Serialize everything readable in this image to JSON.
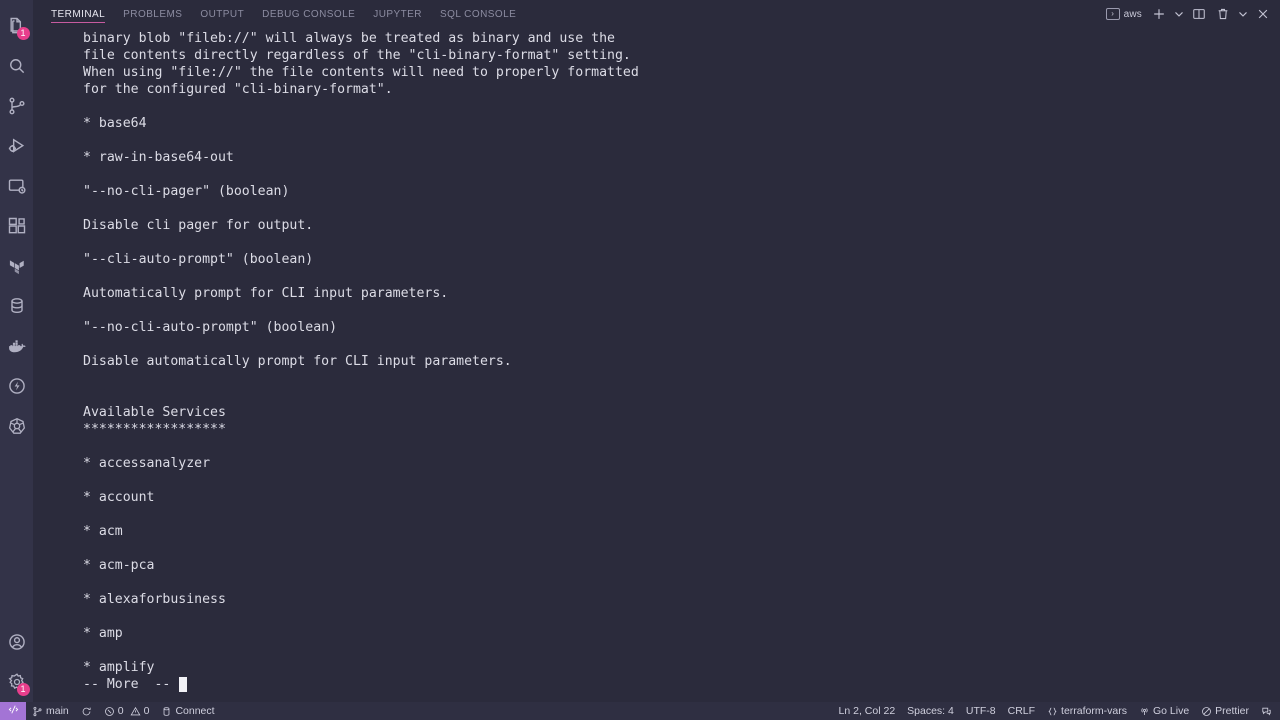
{
  "activity_bar": {
    "top_items": [
      {
        "name": "explorer",
        "icon": "files-icon",
        "badge": "1"
      },
      {
        "name": "search",
        "icon": "search-icon",
        "badge": ""
      },
      {
        "name": "source-control",
        "icon": "source-control-icon",
        "badge": ""
      },
      {
        "name": "run-and-debug",
        "icon": "run-debug-icon",
        "badge": ""
      },
      {
        "name": "remote-explorer",
        "icon": "remote-explorer-icon",
        "badge": ""
      },
      {
        "name": "extensions",
        "icon": "extensions-icon",
        "badge": ""
      },
      {
        "name": "terraform",
        "icon": "terraform-icon",
        "badge": ""
      },
      {
        "name": "database",
        "icon": "database-icon",
        "badge": ""
      },
      {
        "name": "docker",
        "icon": "docker-icon",
        "badge": ""
      },
      {
        "name": "thunder-client",
        "icon": "lightning-icon",
        "badge": ""
      },
      {
        "name": "kubernetes",
        "icon": "kubernetes-icon",
        "badge": ""
      }
    ],
    "bottom_items": [
      {
        "name": "accounts",
        "icon": "account-icon",
        "badge": ""
      },
      {
        "name": "manage-settings",
        "icon": "gear-icon",
        "badge": "1"
      }
    ]
  },
  "panel": {
    "tabs": [
      {
        "label": "TERMINAL",
        "active": true
      },
      {
        "label": "PROBLEMS",
        "active": false
      },
      {
        "label": "OUTPUT",
        "active": false
      },
      {
        "label": "DEBUG CONSOLE",
        "active": false
      },
      {
        "label": "JUPYTER",
        "active": false
      },
      {
        "label": "SQL CONSOLE",
        "active": false
      }
    ],
    "terminal_chip": {
      "label": "aws",
      "icon": "terminal-icon"
    },
    "actions": [
      {
        "name": "new-terminal",
        "icon": "plus-icon",
        "title": "+"
      },
      {
        "name": "terminal-profile-dropdown",
        "icon": "chevron-down-icon",
        "title": "v"
      },
      {
        "name": "split-terminal",
        "icon": "split-icon",
        "title": "split"
      },
      {
        "name": "kill-terminal",
        "icon": "trash-icon",
        "title": "trash"
      },
      {
        "name": "maximize-panel",
        "icon": "chevron-down-icon",
        "title": "v"
      },
      {
        "name": "close-panel",
        "icon": "close-icon",
        "title": "x"
      }
    ]
  },
  "terminal": {
    "lines": [
      "binary blob \"fileb://\" will always be treated as binary and use the",
      "file contents directly regardless of the \"cli-binary-format\" setting.",
      "When using \"file://\" the file contents will need to properly formatted",
      "for the configured \"cli-binary-format\".",
      "",
      "* base64",
      "",
      "* raw-in-base64-out",
      "",
      "\"--no-cli-pager\" (boolean)",
      "",
      "Disable cli pager for output.",
      "",
      "\"--cli-auto-prompt\" (boolean)",
      "",
      "Automatically prompt for CLI input parameters.",
      "",
      "\"--no-cli-auto-prompt\" (boolean)",
      "",
      "Disable automatically prompt for CLI input parameters.",
      "",
      "",
      "Available Services",
      "******************",
      "",
      "* accessanalyzer",
      "",
      "* account",
      "",
      "* acm",
      "",
      "* acm-pca",
      "",
      "* alexaforbusiness",
      "",
      "* amp",
      "",
      "* amplify"
    ],
    "prompt": "-- More  -- "
  },
  "status_bar": {
    "remote_icon": "remote-window-icon",
    "left": [
      {
        "name": "branch",
        "icon": "source-control-icon",
        "label": "main"
      },
      {
        "name": "sync-changes",
        "icon": "sync-icon",
        "label": ""
      },
      {
        "name": "problems",
        "icon": "error-warning-icon",
        "label": "0 0"
      },
      {
        "name": "connect",
        "icon": "database-icon",
        "label": "Connect"
      }
    ],
    "right": [
      {
        "name": "editor-position",
        "icon": "",
        "label": "Ln 2, Col 22"
      },
      {
        "name": "indentation",
        "icon": "",
        "label": "Spaces: 4"
      },
      {
        "name": "encoding",
        "icon": "",
        "label": "UTF-8"
      },
      {
        "name": "eol",
        "icon": "",
        "label": "CRLF"
      },
      {
        "name": "language-mode",
        "icon": "brackets-icon",
        "label": "terraform-vars"
      },
      {
        "name": "go-live",
        "icon": "broadcast-icon",
        "label": "Go Live"
      },
      {
        "name": "prettier",
        "icon": "check-circle-icon",
        "label": "Prettier"
      },
      {
        "name": "notifications",
        "icon": "feedback-icon",
        "label": ""
      }
    ]
  },
  "colors": {
    "panel_background": "#2b2b3c",
    "activity_bar_background": "#333348",
    "status_bar_background": "#2f2f42",
    "accent_pink": "#e83e8c",
    "tab_underline": "#c75ba0",
    "remote_purple": "#a374d5",
    "text_primary": "#dcdce6",
    "text_muted": "#8c8ca1"
  }
}
